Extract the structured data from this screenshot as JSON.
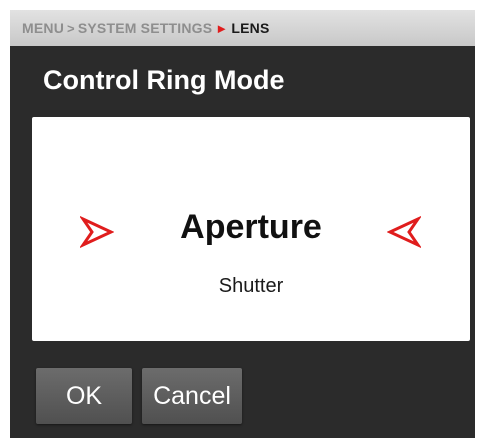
{
  "breadcrumb": {
    "menu": "MENU",
    "system_settings": "SYSTEM SETTINGS",
    "current": "LENS",
    "separator_icon": "chevron-right-icon",
    "active_separator_color": "#e01d1d"
  },
  "dialog": {
    "title": "Control Ring Mode",
    "selected_value": "Aperture",
    "next_value": "Shutter",
    "left_arrow_icon": "arrow-right-icon",
    "right_arrow_icon": "arrow-left-icon",
    "arrow_color": "#e01d1d"
  },
  "buttons": {
    "ok_label": "OK",
    "cancel_label": "Cancel"
  }
}
